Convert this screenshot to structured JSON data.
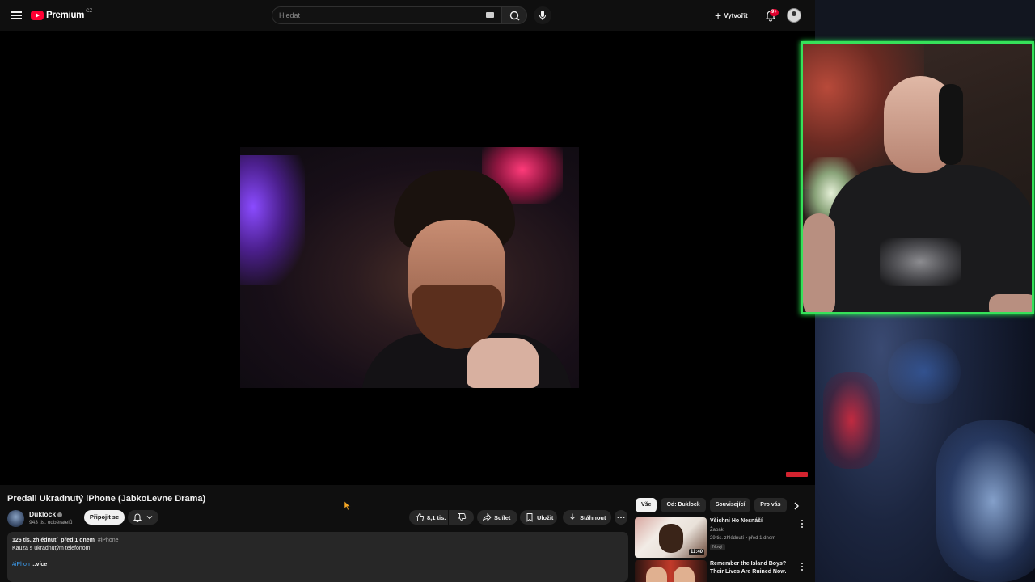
{
  "header": {
    "logo_text": "Premium",
    "country_code": "CZ",
    "search_placeholder": "Hledat",
    "create_label": "Vytvořit",
    "notifications_badge": "9+"
  },
  "video": {
    "title": "Predali Ukradnutý iPhone (JabkoLevne Drama)",
    "channel_name": "Duklock",
    "subscribers": "943 tis. odběratelů",
    "join_label": "Připojit se",
    "likes": "8,1 tis.",
    "share_label": "Sdílet",
    "save_label": "Uložit",
    "download_label": "Stáhnout"
  },
  "description": {
    "views": "126 tis. zhlédnutí",
    "date": "před 1 dnem",
    "hashtag": "#iPhone",
    "text": "Kauza s ukradnutým telefónom.",
    "hashtag_truncated": "#iPhon",
    "more_label": "...více"
  },
  "chips": [
    "Vše",
    "Od: Duklock",
    "Související",
    "Pro vás"
  ],
  "recommendations": [
    {
      "title": "Všichni Ho Nesnáší",
      "channel": "Žabák",
      "meta": "29 tis. zhlédnutí • před 1 dnem",
      "tag": "Nový",
      "duration": "11:40"
    },
    {
      "title": "Remember the Island Boys? Their Lives Are Ruined Now."
    }
  ],
  "colors": {
    "background": "#0f0f0f",
    "accent_red": "#ff0033",
    "webcam_border": "#36e15a",
    "link_blue": "#3ea6ff"
  }
}
